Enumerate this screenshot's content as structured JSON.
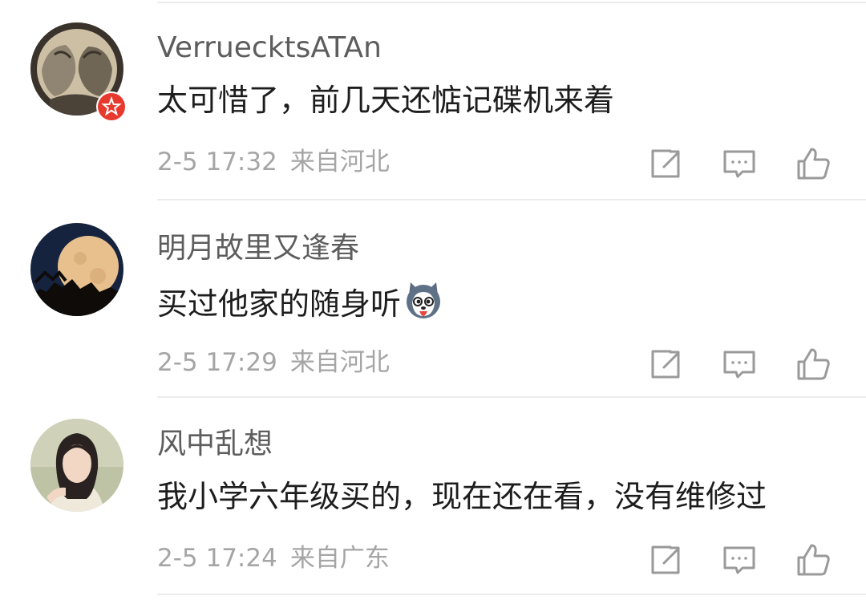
{
  "comments": [
    {
      "username": "VerruecktsATAn",
      "text": "太可惜了，前几天还惦记碟机来着",
      "time": "2-5 17:32",
      "location": "来自河北",
      "avatar_icon": "engraving-portrait-avatar",
      "badge_icon": "red-star-badge-icon"
    },
    {
      "username": "明月故里又逢春",
      "text": "买过他家的随身听",
      "emoji_icon": "husky-dog-emoji",
      "time": "2-5 17:29",
      "location": "来自河北",
      "avatar_icon": "full-moon-avatar"
    },
    {
      "username": "风中乱想",
      "text": "我小学六年级买的，现在还在看，没有维修过",
      "time": "2-5 17:24",
      "location": "来自广东",
      "avatar_icon": "woman-portrait-avatar"
    }
  ],
  "action_icons": [
    "repost-icon",
    "reply-icon",
    "like-icon"
  ],
  "colors": {
    "username": "#5d5d5d",
    "text": "#1d1d1d",
    "meta": "#a5a5a5",
    "icon": "#9a9a9a",
    "divider": "#ececec",
    "badge": "#e8392e"
  }
}
